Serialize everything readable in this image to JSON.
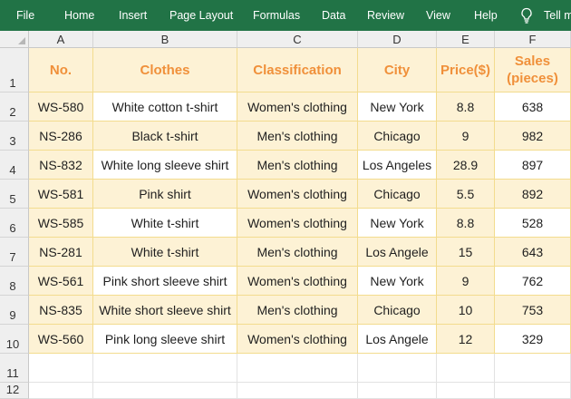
{
  "ribbon": {
    "items": [
      "File",
      "Home",
      "Insert",
      "Page Layout",
      "Formulas",
      "Data",
      "Review",
      "View",
      "Help"
    ],
    "tell_me": "Tell m"
  },
  "columns": [
    "A",
    "B",
    "C",
    "D",
    "E",
    "F"
  ],
  "rows": [
    "1",
    "2",
    "3",
    "4",
    "5",
    "6",
    "7",
    "8",
    "9",
    "10",
    "11",
    "12"
  ],
  "table": {
    "headers": [
      "No.",
      "Clothes",
      "Classification",
      "City",
      "Price($)",
      "Sales\n(pieces)"
    ],
    "data": [
      [
        "WS-580",
        "White cotton t-shirt",
        "Women's clothing",
        "New York",
        "8.8",
        "638"
      ],
      [
        "NS-286",
        "Black t-shirt",
        "Men's clothing",
        "Chicago",
        "9",
        "982"
      ],
      [
        "NS-832",
        "White long sleeve shirt",
        "Men's clothing",
        "Los Angeles",
        "28.9",
        "897"
      ],
      [
        "WS-581",
        "Pink shirt",
        "Women's clothing",
        "Chicago",
        "5.5",
        "892"
      ],
      [
        "WS-585",
        "White t-shirt",
        "Women's clothing",
        "New York",
        "8.8",
        "528"
      ],
      [
        "NS-281",
        "White t-shirt",
        "Men's clothing",
        "Los Angele",
        "15",
        "643"
      ],
      [
        "WS-561",
        "Pink short sleeve shirt",
        "Women's clothing",
        "New York",
        "9",
        "762"
      ],
      [
        "NS-835",
        "White short sleeve shirt",
        "Men's clothing",
        "Chicago",
        "10",
        "753"
      ],
      [
        "WS-560",
        "Pink long sleeve shirt",
        "Women's clothing",
        "Los Angele",
        "12",
        "329"
      ]
    ]
  }
}
